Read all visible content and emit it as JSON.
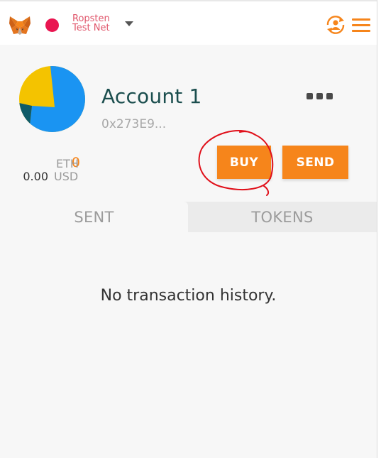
{
  "header": {
    "network_line1": "Ropsten",
    "network_line2": "Test Net",
    "network_color": "#e91550"
  },
  "account": {
    "name": "Account 1",
    "address": "0x273E9...",
    "eth_balance": "0",
    "eth_unit": "ETH",
    "usd_balance": "0.00",
    "usd_unit": "USD"
  },
  "actions": {
    "buy_label": "BUY",
    "send_label": "SEND"
  },
  "tabs": [
    {
      "label": "SENT",
      "active": true
    },
    {
      "label": "TOKENS",
      "active": false
    }
  ],
  "history": {
    "empty_text": "No transaction history."
  },
  "colors": {
    "accent": "#f6851b",
    "account_name": "#1b4e4e",
    "annotation": "#e0101a"
  },
  "icons": [
    "metamask-fox-icon",
    "network-caret-icon",
    "account-switch-icon",
    "hamburger-menu-icon",
    "more-options-icon"
  ]
}
